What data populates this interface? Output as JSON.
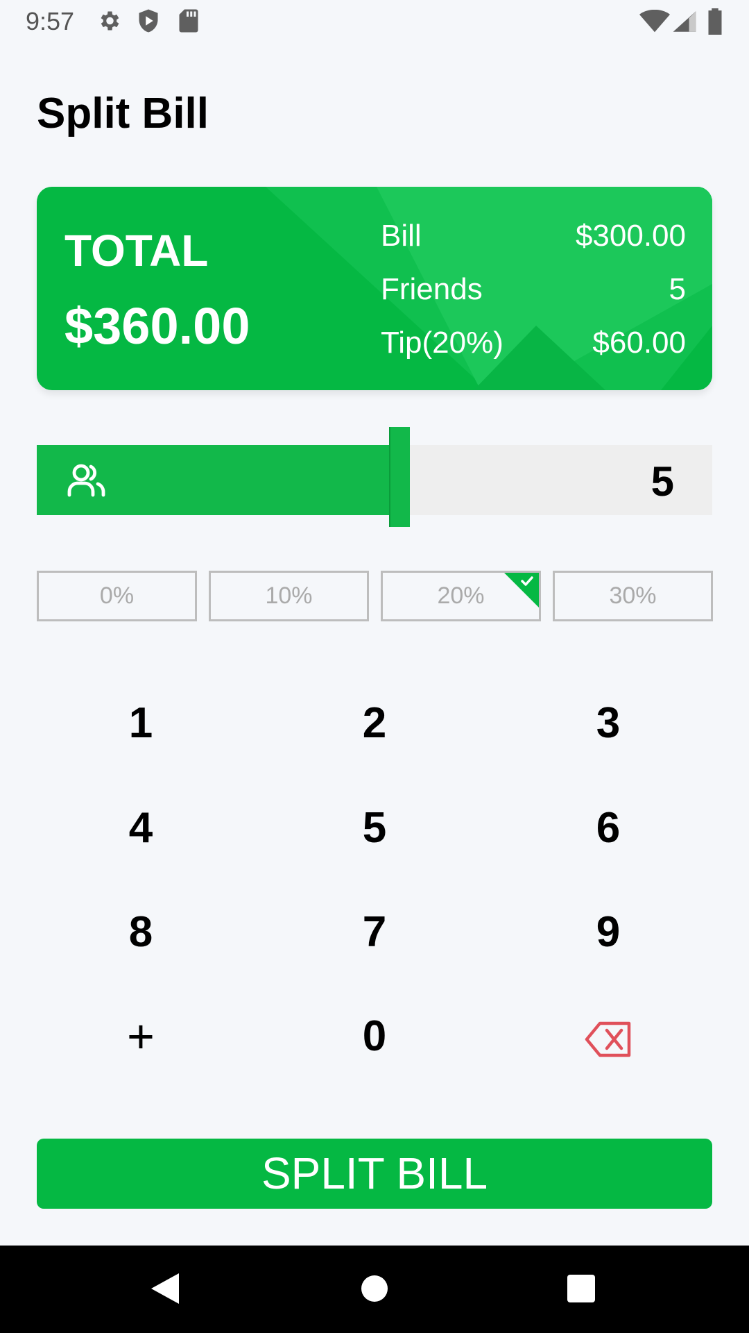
{
  "status_bar": {
    "time": "9:57",
    "icons_left": [
      "gear-icon",
      "shield-play-icon",
      "sd-card-icon"
    ],
    "icons_right": [
      "wifi-icon",
      "signal-icon",
      "battery-icon"
    ]
  },
  "page": {
    "title": "Split Bill"
  },
  "summary": {
    "total_label": "TOTAL",
    "total_value": "$360.00",
    "rows": [
      {
        "label": "Bill",
        "value": "$300.00"
      },
      {
        "label": "Friends",
        "value": "5"
      },
      {
        "label": "Tip(20%)",
        "value": "$60.00"
      }
    ]
  },
  "friends_slider": {
    "icon": "people-icon",
    "value": "5"
  },
  "tip_options": [
    {
      "label": "0%",
      "selected": false
    },
    {
      "label": "10%",
      "selected": false
    },
    {
      "label": "20%",
      "selected": true
    },
    {
      "label": "30%",
      "selected": false
    }
  ],
  "keypad": {
    "rows": [
      [
        "1",
        "2",
        "3"
      ],
      [
        "4",
        "5",
        "6"
      ],
      [
        "8",
        "7",
        "9"
      ],
      [
        "+",
        "0",
        "backspace"
      ]
    ]
  },
  "actions": {
    "split_label": "SPLIT BILL"
  },
  "colors": {
    "accent": "#05b843",
    "backspace": "#e0505a"
  },
  "nav_bar": {
    "icons": [
      "back-icon",
      "home-icon",
      "recents-icon"
    ]
  }
}
